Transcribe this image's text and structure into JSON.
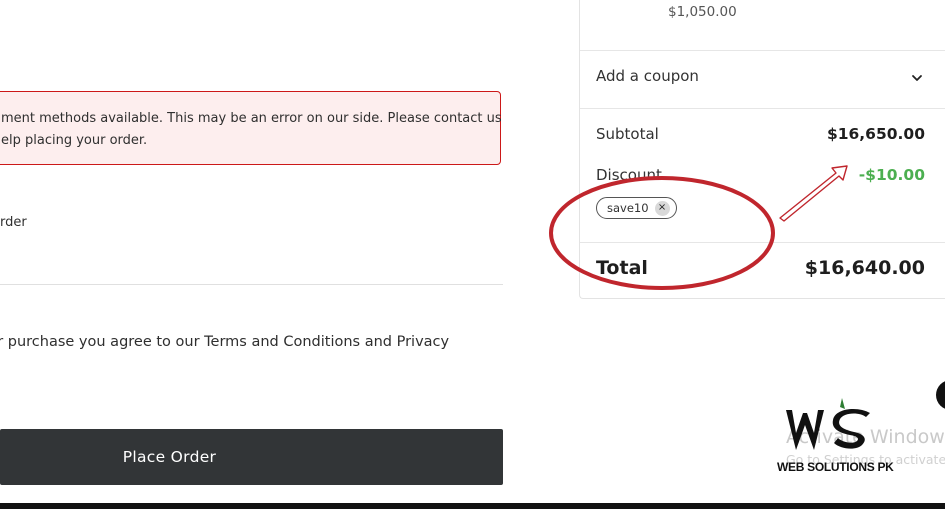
{
  "checkout": {
    "error_line_1": "ment methods available. This may be an error on our side. Please contact us",
    "error_line_2": "elp placing your order.",
    "order_note_fragment": "order",
    "terms_fragment": "ur purchase you agree to our Terms and Conditions and Privacy",
    "place_order_label": "Place Order"
  },
  "summary": {
    "item_price": "$1,050.00",
    "coupon_label": "Add a coupon",
    "subtotal_label": "Subtotal",
    "subtotal_value": "$16,650.00",
    "discount_label": "Discount",
    "discount_value": "-$10.00",
    "coupon_chip": "save10",
    "coupon_remove_glyph": "×",
    "total_label": "Total",
    "total_value": "$16,640.00"
  },
  "overlay": {
    "activate_title": "Activate Windows",
    "activate_sub": "Go to Settings to activate",
    "logo_caption": "WEB SOLUTIONS PK"
  },
  "colors": {
    "error_border": "#cc1818",
    "error_bg": "#fdeeee",
    "button_bg": "#323537",
    "discount_green": "#4caf50",
    "annotation_red": "#c0262d"
  },
  "icons": [
    "chevron-down-icon",
    "close-icon",
    "ws-logo-icon"
  ]
}
